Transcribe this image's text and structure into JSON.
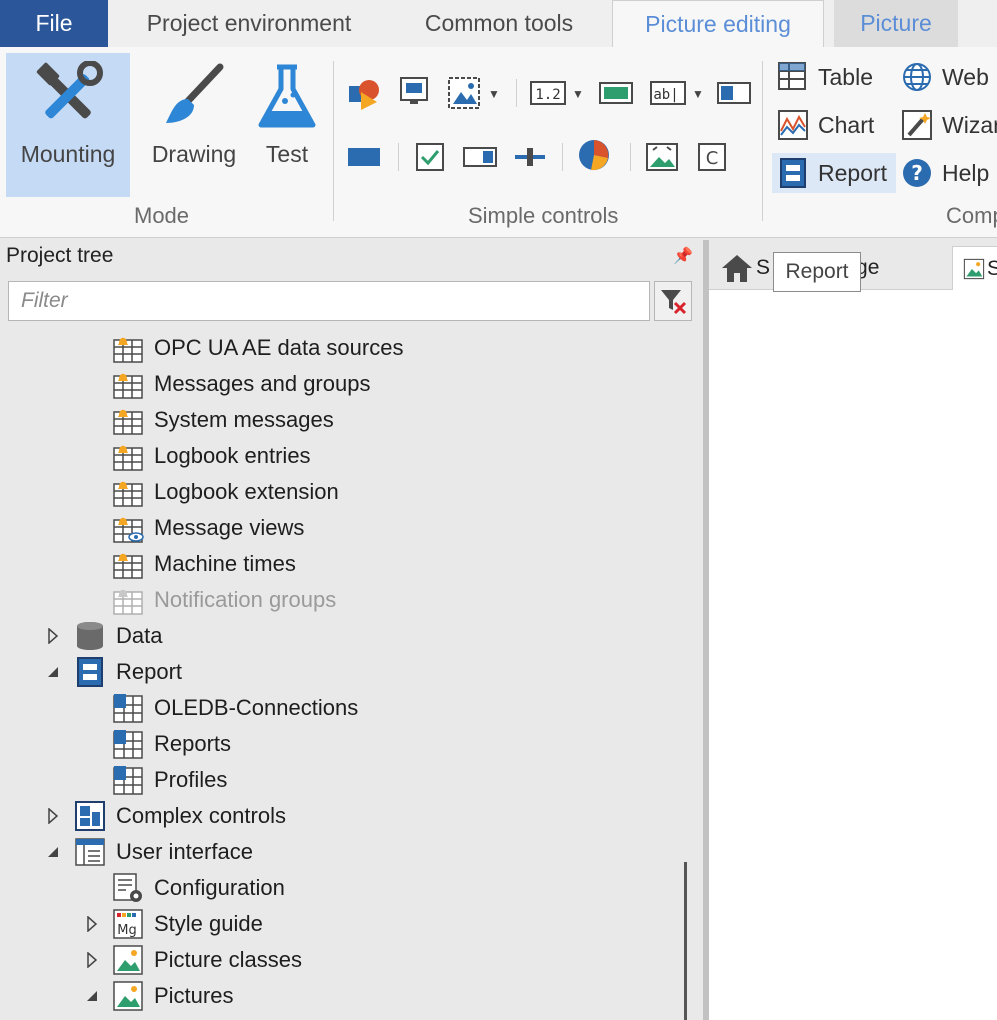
{
  "tabs": {
    "file": "File",
    "project_environment": "Project environment",
    "common_tools": "Common tools",
    "picture_editing": "Picture editing",
    "picture": "Picture"
  },
  "ribbon": {
    "mode": {
      "label": "Mode",
      "mounting": "Mounting",
      "drawing": "Drawing",
      "test": "Test"
    },
    "simple_controls": {
      "label": "Simple controls"
    },
    "complex": {
      "label": "Comp",
      "table": "Table",
      "chart": "Chart",
      "report": "Report",
      "web": "Web",
      "wizard": "Wizar",
      "help": "Help"
    }
  },
  "pane": {
    "title": "Project tree",
    "filter_placeholder": "Filter"
  },
  "tree": {
    "opc_ua": "OPC UA AE data sources",
    "messages_groups": "Messages and groups",
    "system_messages": "System messages",
    "logbook_entries": "Logbook entries",
    "logbook_extension": "Logbook extension",
    "message_views": "Message views",
    "machine_times": "Machine times",
    "notification_groups": "Notification groups",
    "data": "Data",
    "report": "Report",
    "oledb": "OLEDB-Connections",
    "reports": "Reports",
    "profiles": "Profiles",
    "complex_controls": "Complex controls",
    "user_interface": "User interface",
    "configuration": "Configuration",
    "style_guide": "Style guide",
    "picture_classes": "Picture classes",
    "pictures": "Pictures"
  },
  "doc_tabs": {
    "tab1_prefix": "S",
    "tab1_suffix": "ge",
    "tab2_prefix": "S"
  },
  "tooltip": "Report",
  "colors": {
    "accent": "#2b579a",
    "tab_highlight": "#5b8ed6",
    "active_button": "#c5daf5"
  }
}
